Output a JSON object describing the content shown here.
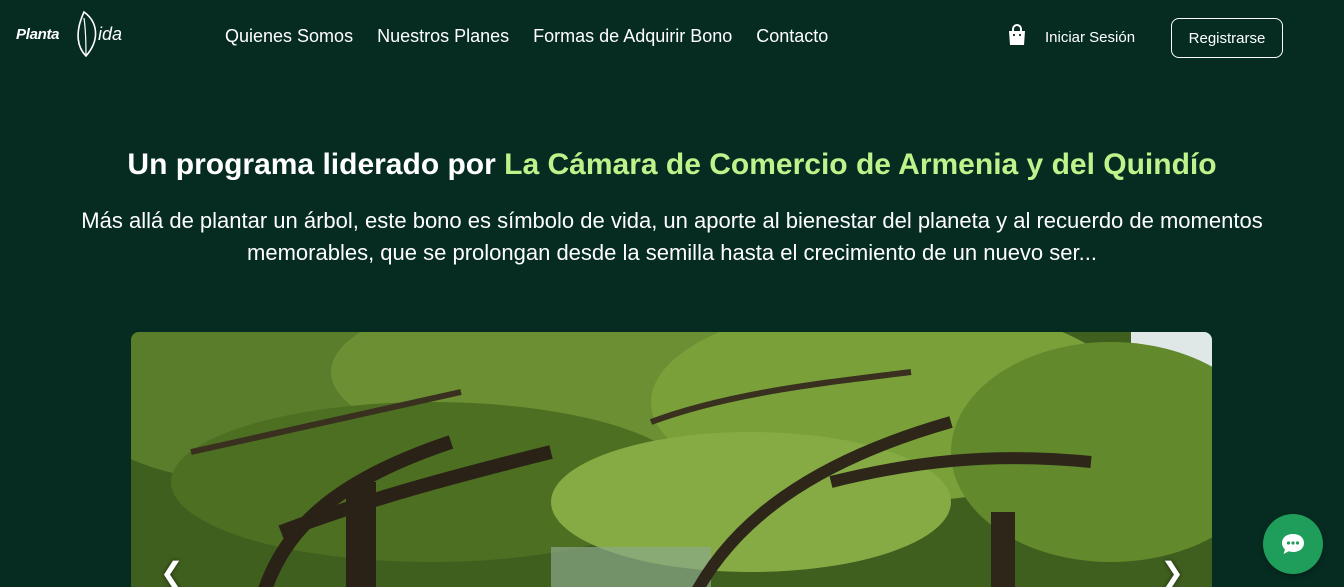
{
  "brand": {
    "logo_text_left": "Planta",
    "logo_text_right": "ida"
  },
  "nav": {
    "items": [
      {
        "label": "Quienes Somos"
      },
      {
        "label": "Nuestros Planes"
      },
      {
        "label": "Formas de Adquirir Bono"
      },
      {
        "label": "Contacto"
      }
    ]
  },
  "account": {
    "login_label": "Iniciar Sesión",
    "register_label": "Registrarse",
    "cart_icon": "shopping-bag-icon"
  },
  "hero": {
    "title_prefix": "Un programa liderado por ",
    "title_accent": "La Cámara de Comercio de Armenia y del Quindío",
    "description": "Más allá de plantar un árbol, este bono es símbolo de vida, un aporte al bienestar del planeta y al recuerdo de momentos memorables, que se prolongan desde la semilla hasta el crecimiento de un nuevo ser..."
  },
  "carousel": {
    "prev_symbol": "❮",
    "next_symbol": "❯",
    "image_subject": "forest-trees"
  },
  "chat": {
    "icon": "chat-bubble-icon"
  },
  "colors": {
    "background": "#062c22",
    "accent": "#bff28a",
    "chat_button": "#1f9d5a"
  }
}
